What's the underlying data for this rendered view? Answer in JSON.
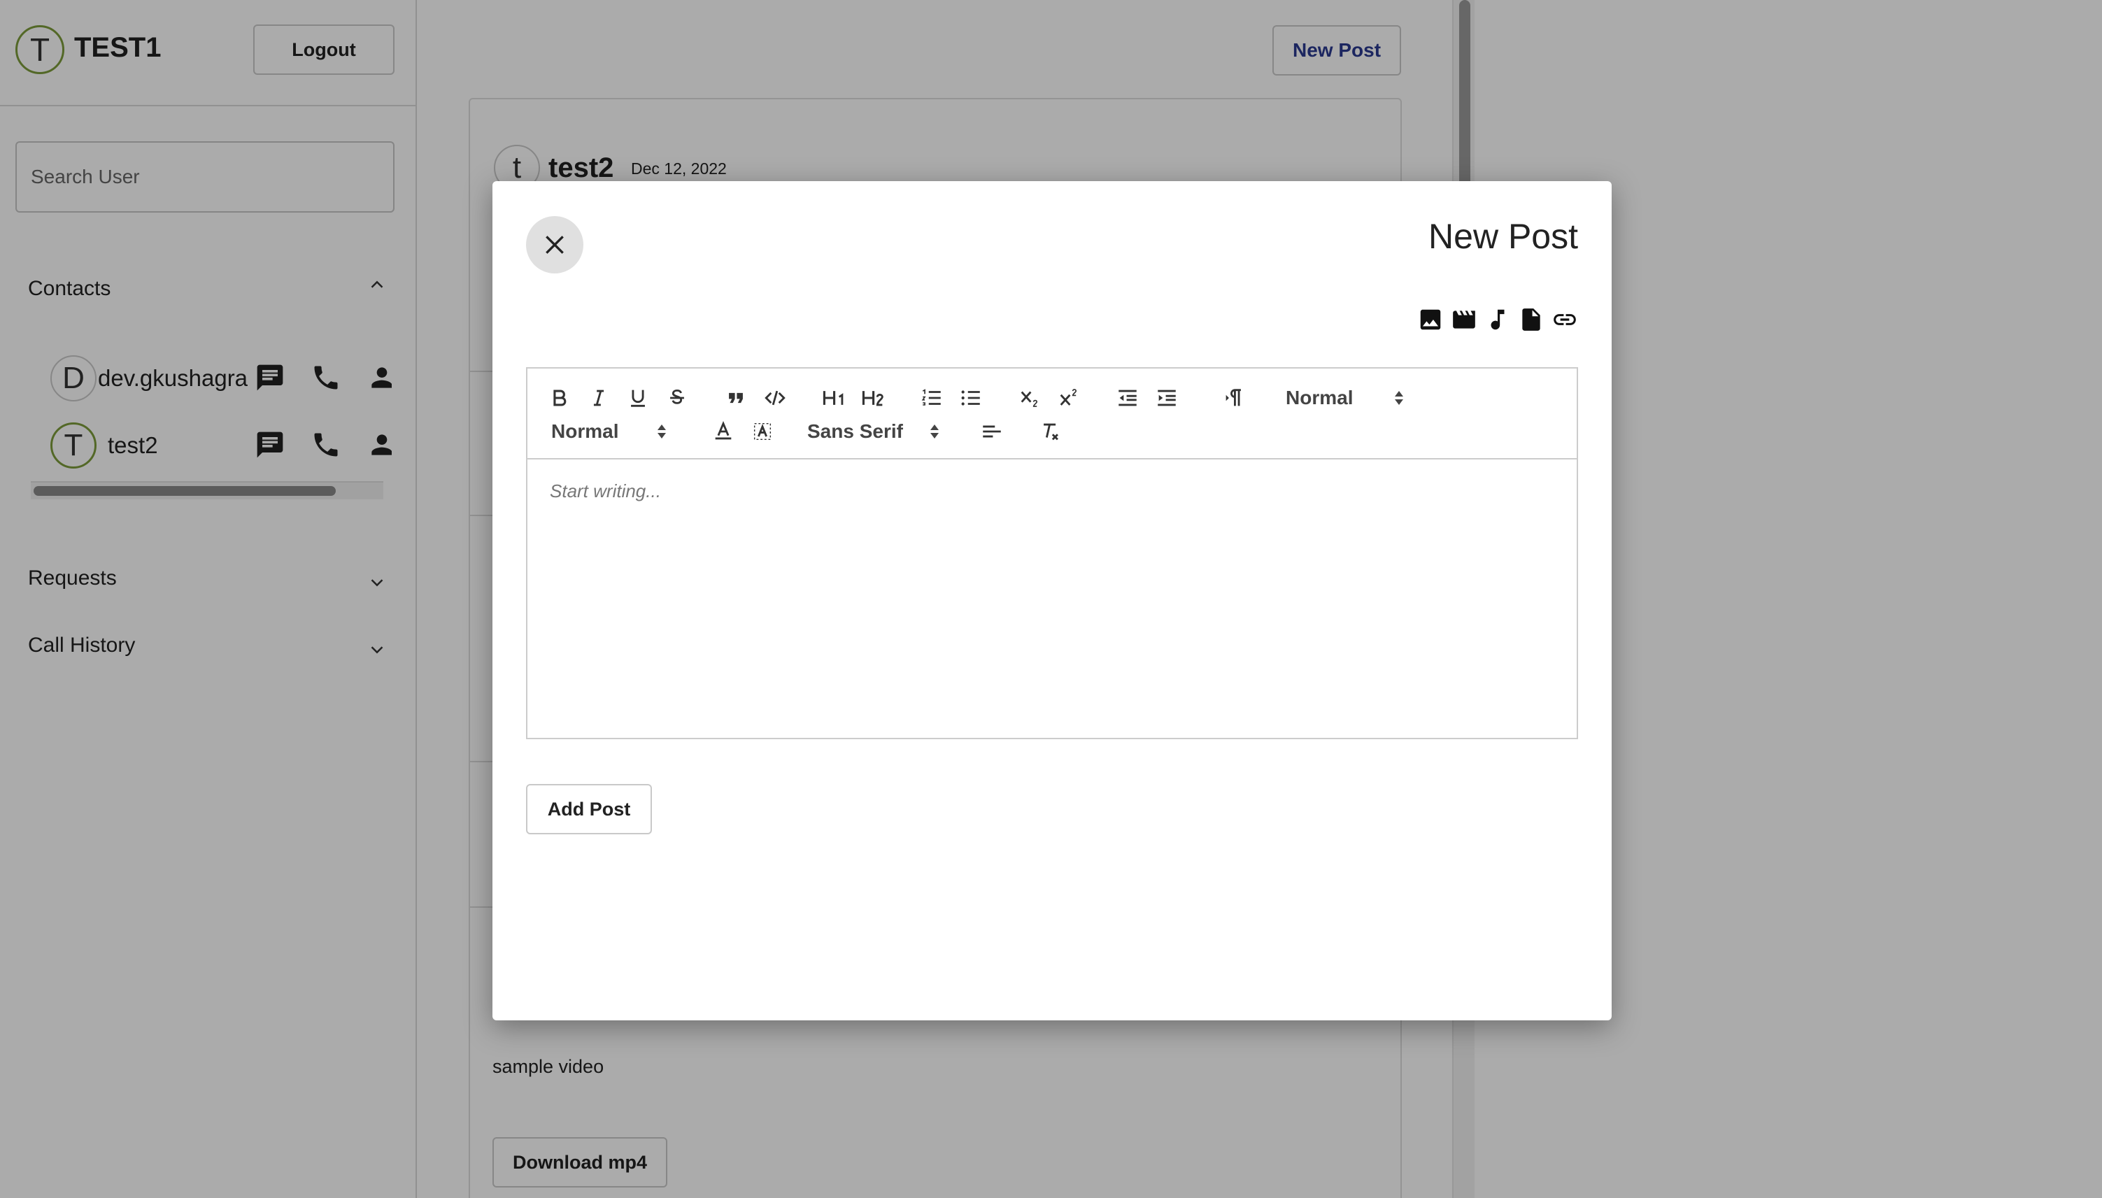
{
  "user": {
    "initial": "T",
    "name": "TEST1"
  },
  "header": {
    "logout_label": "Logout"
  },
  "search": {
    "placeholder": "Search User"
  },
  "contacts": {
    "title": "Contacts",
    "items": [
      {
        "initial": "D",
        "name": "dev.gkushagra"
      },
      {
        "initial": "T",
        "name": "test2"
      }
    ]
  },
  "sections": {
    "requests": "Requests",
    "call_history": "Call History"
  },
  "feed": {
    "new_post_label": "New Post",
    "post": {
      "initial": "t",
      "user": "test2",
      "date": "Dec 12, 2022",
      "text": "sample video",
      "download_label": "Download mp4"
    }
  },
  "modal": {
    "title": "New Post",
    "media_icons": [
      "image-icon",
      "video-icon",
      "audio-icon",
      "document-icon",
      "link-icon"
    ],
    "toolbar": {
      "header_select": "Normal",
      "size_select": "Normal",
      "font_select": "Sans Serif"
    },
    "editor_placeholder": "Start writing...",
    "add_post_label": "Add Post"
  },
  "colors": {
    "avatar_ring": "#7d9c3b",
    "new_post_text": "#2b3a8f",
    "overlay": "rgba(0,0,0,0.33)"
  }
}
